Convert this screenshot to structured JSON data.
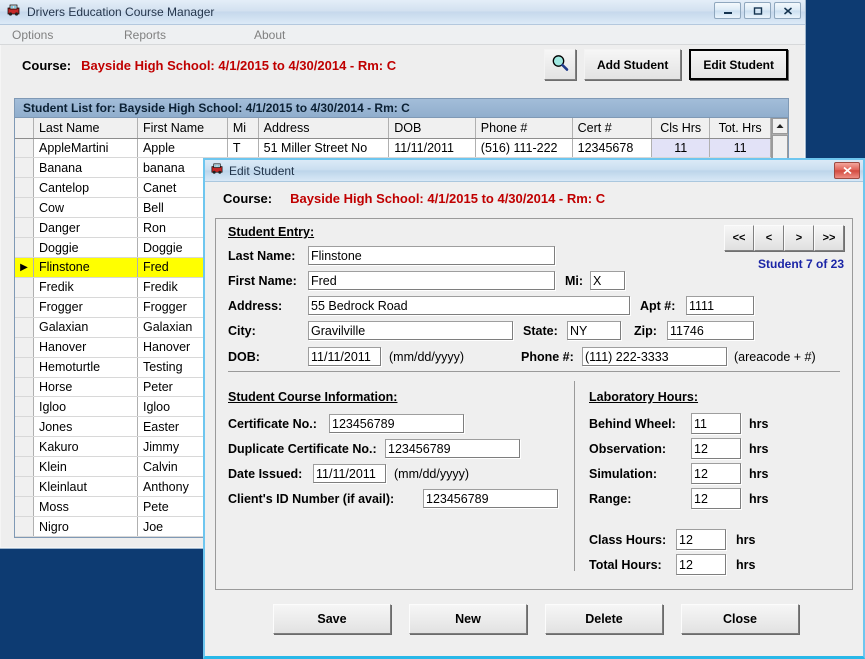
{
  "main_window": {
    "title": "Drivers Education Course Manager",
    "app_icon": "car-icon",
    "window_buttons": {
      "minimize": "minimize-icon",
      "maximize": "maximize-icon",
      "close": "close-icon"
    },
    "menubar": [
      "Options",
      "Reports",
      "About"
    ],
    "course": {
      "label": "Course:",
      "value": "Bayside High School: 4/1/2015 to 4/30/2014 - Rm: C"
    },
    "toolbar": {
      "search_icon": "magnifier-icon",
      "add_student": "Add Student",
      "edit_student": "Edit Student"
    },
    "list_header": "Student List for: Bayside High School: 4/1/2015 to 4/30/2014 - Rm: C",
    "grid": {
      "columns": [
        "",
        "Last Name",
        "First Name",
        "Mi",
        "Address",
        "DOB",
        "Phone #",
        "Cert #",
        "Cls Hrs",
        "Tot. Hrs"
      ],
      "rows": [
        {
          "marker": "",
          "last": "AppleMartini",
          "first": "Apple",
          "mi": "T",
          "address": "51 Miller Street No",
          "dob": "11/11/2011",
          "phone": "(516) 111-222",
          "cert": "12345678",
          "cls": "11",
          "tot": "11",
          "selected": false
        },
        {
          "marker": "",
          "last": "Banana",
          "first": "banana",
          "mi": "",
          "address": "",
          "dob": "",
          "phone": "",
          "cert": "",
          "cls": "",
          "tot": "",
          "selected": false
        },
        {
          "marker": "",
          "last": "Cantelop",
          "first": "Canet",
          "mi": "",
          "address": "",
          "dob": "",
          "phone": "",
          "cert": "",
          "cls": "",
          "tot": "",
          "selected": false
        },
        {
          "marker": "",
          "last": "Cow",
          "first": "Bell",
          "mi": "",
          "address": "",
          "dob": "",
          "phone": "",
          "cert": "",
          "cls": "",
          "tot": "",
          "selected": false
        },
        {
          "marker": "",
          "last": "Danger",
          "first": "Ron",
          "mi": "",
          "address": "",
          "dob": "",
          "phone": "",
          "cert": "",
          "cls": "",
          "tot": "",
          "selected": false
        },
        {
          "marker": "",
          "last": "Doggie",
          "first": "Doggie",
          "mi": "",
          "address": "",
          "dob": "",
          "phone": "",
          "cert": "",
          "cls": "",
          "tot": "",
          "selected": false
        },
        {
          "marker": "▶",
          "last": "Flinstone",
          "first": "Fred",
          "mi": "",
          "address": "",
          "dob": "",
          "phone": "",
          "cert": "",
          "cls": "",
          "tot": "",
          "selected": true
        },
        {
          "marker": "",
          "last": "Fredik",
          "first": "Fredik",
          "mi": "",
          "address": "",
          "dob": "",
          "phone": "",
          "cert": "",
          "cls": "",
          "tot": "",
          "selected": false
        },
        {
          "marker": "",
          "last": "Frogger",
          "first": "Frogger",
          "mi": "",
          "address": "",
          "dob": "",
          "phone": "",
          "cert": "",
          "cls": "",
          "tot": "",
          "selected": false
        },
        {
          "marker": "",
          "last": "Galaxian",
          "first": "Galaxian",
          "mi": "",
          "address": "",
          "dob": "",
          "phone": "",
          "cert": "",
          "cls": "",
          "tot": "",
          "selected": false
        },
        {
          "marker": "",
          "last": "Hanover",
          "first": "Hanover",
          "mi": "",
          "address": "",
          "dob": "",
          "phone": "",
          "cert": "",
          "cls": "",
          "tot": "",
          "selected": false
        },
        {
          "marker": "",
          "last": "Hemoturtle",
          "first": "Testing",
          "mi": "",
          "address": "",
          "dob": "",
          "phone": "",
          "cert": "",
          "cls": "",
          "tot": "",
          "selected": false
        },
        {
          "marker": "",
          "last": "Horse",
          "first": "Peter",
          "mi": "",
          "address": "",
          "dob": "",
          "phone": "",
          "cert": "",
          "cls": "",
          "tot": "",
          "selected": false
        },
        {
          "marker": "",
          "last": "Igloo",
          "first": "Igloo",
          "mi": "",
          "address": "",
          "dob": "",
          "phone": "",
          "cert": "",
          "cls": "",
          "tot": "",
          "selected": false
        },
        {
          "marker": "",
          "last": "Jones",
          "first": "Easter",
          "mi": "",
          "address": "",
          "dob": "",
          "phone": "",
          "cert": "",
          "cls": "",
          "tot": "",
          "selected": false
        },
        {
          "marker": "",
          "last": "Kakuro",
          "first": "Jimmy",
          "mi": "",
          "address": "",
          "dob": "",
          "phone": "",
          "cert": "",
          "cls": "",
          "tot": "",
          "selected": false
        },
        {
          "marker": "",
          "last": "Klein",
          "first": "Calvin",
          "mi": "",
          "address": "",
          "dob": "",
          "phone": "",
          "cert": "",
          "cls": "",
          "tot": "",
          "selected": false
        },
        {
          "marker": "",
          "last": "Kleinlaut",
          "first": "Anthony",
          "mi": "",
          "address": "",
          "dob": "",
          "phone": "",
          "cert": "",
          "cls": "",
          "tot": "",
          "selected": false
        },
        {
          "marker": "",
          "last": "Moss",
          "first": "Pete",
          "mi": "",
          "address": "",
          "dob": "",
          "phone": "",
          "cert": "",
          "cls": "",
          "tot": "",
          "selected": false
        },
        {
          "marker": "",
          "last": "Nigro",
          "first": "Joe",
          "mi": "",
          "address": "",
          "dob": "",
          "phone": "",
          "cert": "",
          "cls": "",
          "tot": "",
          "selected": false
        }
      ]
    }
  },
  "dialog": {
    "title": "Edit Student",
    "app_icon": "car-icon",
    "close_icon": "close-icon",
    "course": {
      "label": "Course:",
      "value": "Bayside High School: 4/1/2015 to 4/30/2014 - Rm: C"
    },
    "nav": {
      "first": "<<",
      "prev": "<",
      "next": ">",
      "last": ">>",
      "counter": "Student 7 of 23"
    },
    "student_entry": {
      "section_title": "Student Entry:",
      "last_name_label": "Last Name:",
      "last_name_value": "Flinstone",
      "first_name_label": "First Name:",
      "first_name_value": "Fred",
      "mi_label": "Mi:",
      "mi_value": "X",
      "address_label": "Address:",
      "address_value": "55 Bedrock Road",
      "apt_label": "Apt #:",
      "apt_value": "1111",
      "city_label": "City:",
      "city_value": "Gravilville",
      "state_label": "State:",
      "state_value": "NY",
      "zip_label": "Zip:",
      "zip_value": "11746",
      "dob_label": "DOB:",
      "dob_value": "11/11/2011",
      "dob_hint": "(mm/dd/yyyy)",
      "phone_label": "Phone #:",
      "phone_value": "(111) 222-3333",
      "phone_hint": "(areacode + #)"
    },
    "course_info": {
      "section_title": "Student Course Information:",
      "certificate_label": "Certificate No.:",
      "certificate_value": "123456789",
      "duplicate_label": "Duplicate Certificate No.:",
      "duplicate_value": "123456789",
      "date_issued_label": "Date Issued:",
      "date_issued_value": "11/11/2011",
      "date_issued_hint": "(mm/dd/yyyy)",
      "client_id_label": "Client's ID Number (if avail):",
      "client_id_value": "123456789"
    },
    "lab_hours": {
      "section_title": "Laboratory Hours:",
      "unit": "hrs",
      "rows": [
        {
          "label": "Behind Wheel:",
          "value": "11"
        },
        {
          "label": "Observation:",
          "value": "12"
        },
        {
          "label": "Simulation:",
          "value": "12"
        },
        {
          "label": "Range:",
          "value": "12"
        }
      ],
      "class_hours_label": "Class Hours:",
      "class_hours_value": "12",
      "total_hours_label": "Total Hours:",
      "total_hours_value": "12"
    },
    "buttons": {
      "save": "Save",
      "new": "New",
      "delete": "Delete",
      "close": "Close"
    }
  },
  "colors": {
    "desktop": "#0d3b72",
    "course_red": "#c00000",
    "counter_blue": "#1b25a6",
    "selected_row": "#ffff00",
    "hours_cell": "#e2e2f7",
    "list_header": "#90aecd"
  }
}
